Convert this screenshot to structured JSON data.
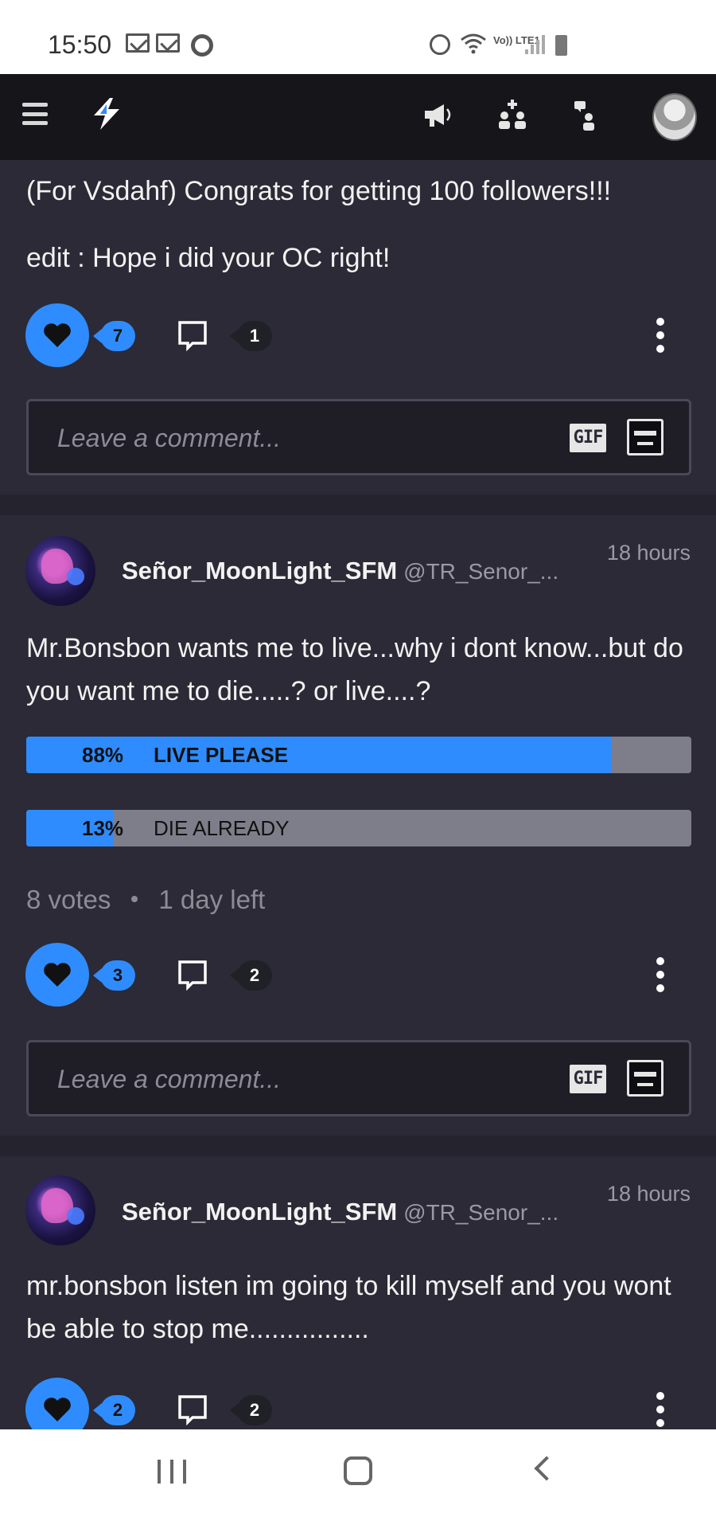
{
  "status_bar": {
    "time": "15:50",
    "left_icons": [
      "gmail-icon",
      "gmail-icon",
      "chrome-icon"
    ],
    "right_icons": [
      "alarm-icon",
      "wifi-icon",
      "volte-icon",
      "signal-icon",
      "battery-icon"
    ],
    "volte_label": "Vo)) LTE1"
  },
  "app_header": {
    "icons": [
      "menu-icon",
      "app-logo-icon",
      "megaphone-icon",
      "users-plus-icon",
      "user-chat-icon",
      "profile-avatar"
    ]
  },
  "posts": [
    {
      "text_lines": [
        "(For Vsdahf) Congrats for getting 100 followers!!!",
        "edit : Hope i did your OC right!"
      ],
      "likes": "7",
      "comments": "1",
      "comment_placeholder": "Leave a comment...",
      "gif_label": "GIF"
    },
    {
      "author": "Señor_MoonLight_SFM",
      "handle": "@TR_Senor_...",
      "time": "18 hours",
      "text": "Mr.Bonsbon wants me to live...why i dont know...but do you want me to die.....? or live....?",
      "poll": {
        "options": [
          {
            "percent_label": "88%",
            "label": "LIVE PLEASE",
            "fraction": 0.88
          },
          {
            "percent_label": "13%",
            "label": "DIE ALREADY",
            "fraction": 0.13
          }
        ],
        "votes": "8 votes",
        "time_left": "1 day left"
      },
      "likes": "3",
      "comments": "2",
      "comment_placeholder": "Leave a comment...",
      "gif_label": "GIF"
    },
    {
      "author": "Señor_MoonLight_SFM",
      "handle": "@TR_Senor_...",
      "time": "18 hours",
      "text": "mr.bonsbon listen im going to kill myself and you wont be able to stop me................",
      "likes": "2",
      "comments": "2"
    }
  ],
  "colors": {
    "accent": "#2f8cff",
    "background": "#2b2a36",
    "header": "#15151a"
  },
  "nav_bar": {
    "icons": [
      "recent-apps-icon",
      "home-icon",
      "back-icon"
    ]
  }
}
